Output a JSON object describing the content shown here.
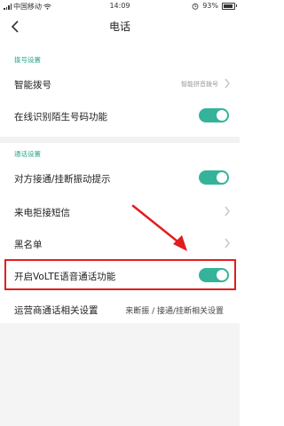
{
  "status": {
    "carrier": "中国移动",
    "time": "14:09",
    "battery": "93%"
  },
  "titlebar": {
    "title": "电话",
    "back_icon": "chevron-left-icon"
  },
  "sections": {
    "dial": "拨号设置",
    "call": "通话设置"
  },
  "rows": {
    "smart_dial": {
      "label": "智能拨号",
      "value": "智能拼音拨号"
    },
    "online_id": {
      "label": "在线识别陌生号码功能",
      "toggle": "on"
    },
    "vibrate": {
      "label": "对方接通/挂断振动提示",
      "toggle": "on"
    },
    "reject_sms": {
      "label": "来电拒接短信"
    },
    "blacklist": {
      "label": "黑名单"
    },
    "volte": {
      "label": "开启VoLTE语音通话功能",
      "toggle": "on"
    },
    "carrier_settings": {
      "label": "运营商通话相关设置",
      "value": "来断振 / 接通/挂断相关设置"
    }
  },
  "colors": {
    "accent": "#34b39a",
    "section_text": "#2aa58a",
    "highlight": "#e11d1d"
  }
}
